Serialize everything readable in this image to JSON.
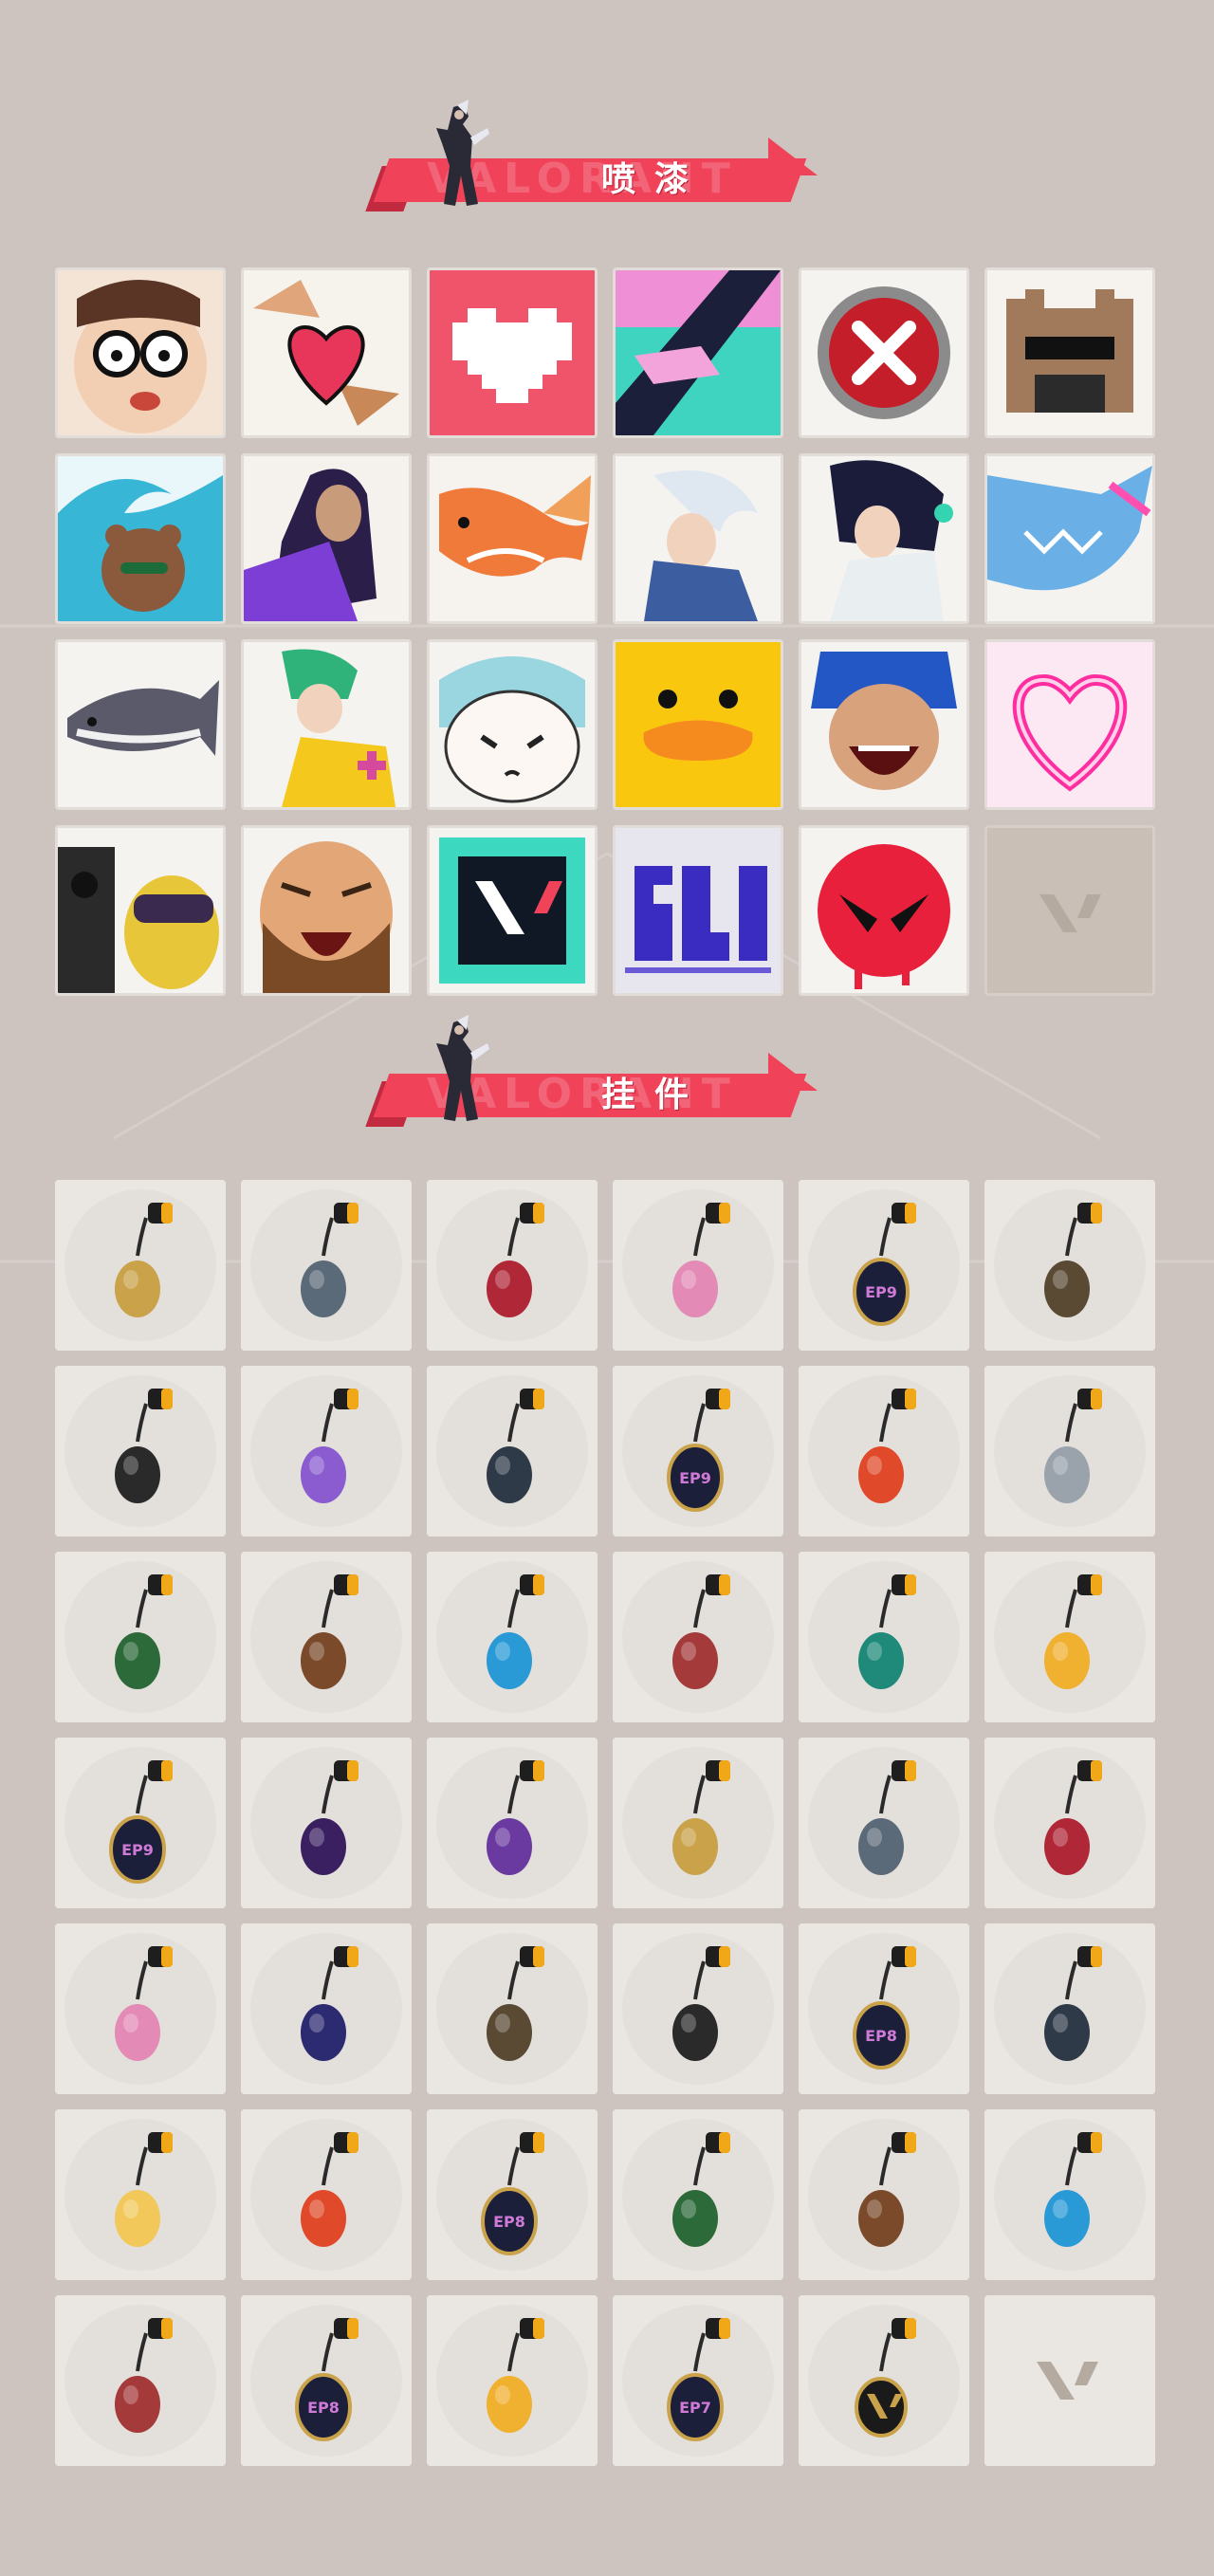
{
  "sections": {
    "sprays": {
      "title": "喷漆",
      "ghost_text": "VALORANT"
    },
    "buddies": {
      "title": "挂件",
      "ghost_text": "VALORANT"
    }
  },
  "colors": {
    "background": "#cdc4bf",
    "banner_red": "#f0435a",
    "tile": "#f1efec"
  },
  "sprays": [
    {
      "icon": "cartoon-face-glasses-spray"
    },
    {
      "icon": "hands-heart-spray"
    },
    {
      "icon": "pixel-heart-spray"
    },
    {
      "icon": "pink-gun-stripe-spray"
    },
    {
      "icon": "red-x-button-spray"
    },
    {
      "icon": "pixel-cat-sunglasses-spray"
    },
    {
      "icon": "bear-wave-spray"
    },
    {
      "icon": "reyna-agent-spray"
    },
    {
      "icon": "koi-fish-spray"
    },
    {
      "icon": "jett-agent-spray"
    },
    {
      "icon": "sage-agent-spray"
    },
    {
      "icon": "blue-shark-spray"
    },
    {
      "icon": "catfish-spray"
    },
    {
      "icon": "skye-agent-spray"
    },
    {
      "icon": "chibi-pouting-spray"
    },
    {
      "icon": "yellow-duck-spray"
    },
    {
      "icon": "neon-agent-yelling-spray"
    },
    {
      "icon": "neon-pink-heart-spray"
    },
    {
      "icon": "gun-masked-banana-spray"
    },
    {
      "icon": "laughing-bearded-man-spray"
    },
    {
      "icon": "valorant-logo-teal-spray"
    },
    {
      "icon": "graffiti-tag-spray"
    },
    {
      "icon": "red-angry-face-spray"
    },
    {
      "icon": "empty-slot-valorant-logo"
    }
  ],
  "buddies": [
    {
      "icon": "gold-cat-buddy"
    },
    {
      "icon": "toaster-buddy"
    },
    {
      "icon": "rope-noose-buddy"
    },
    {
      "icon": "cupcake-buddy"
    },
    {
      "icon": "ep9-medallion-buddy"
    },
    {
      "icon": "backpack-buddy"
    },
    {
      "icon": "black-hook-creature-buddy"
    },
    {
      "icon": "lava-lamp-buddy"
    },
    {
      "icon": "sneaker-buddy"
    },
    {
      "icon": "ep9-medallion-buddy"
    },
    {
      "icon": "purple-pixel-heart-buddy"
    },
    {
      "icon": "cheese-slice-buddy"
    },
    {
      "icon": "skewer-buddy"
    },
    {
      "icon": "robot-figure-buddy"
    },
    {
      "icon": "baseball-bat-buddy"
    },
    {
      "icon": "robot-box-buddy"
    },
    {
      "icon": "lute-buddy"
    },
    {
      "icon": "green-can-buddy"
    },
    {
      "icon": "ep9-medallion-buddy"
    },
    {
      "icon": "gold-robot-buddy"
    },
    {
      "icon": "corgi-buddy"
    },
    {
      "icon": "green-plant-creature-buddy"
    },
    {
      "icon": "raccoon-buddy"
    },
    {
      "icon": "mecha-robot-buddy"
    },
    {
      "icon": "blue-crystal-buddy"
    },
    {
      "icon": "red-blob-buddy"
    },
    {
      "icon": "green-gem-buddy"
    },
    {
      "icon": "sun-cloud-buddy"
    },
    {
      "icon": "ep8-medallion-buddy"
    },
    {
      "icon": "pretzel-buddy"
    },
    {
      "icon": "bottle-buddy"
    },
    {
      "icon": "purple-flame-flower-buddy"
    },
    {
      "icon": "ep8-medallion-buddy"
    },
    {
      "icon": "ufo-buddy"
    },
    {
      "icon": "koi-fish-buddy"
    },
    {
      "icon": "grey-cat-buddy"
    },
    {
      "icon": "potted-plant-buddy"
    },
    {
      "icon": "ep8-medallion-buddy"
    },
    {
      "icon": "lion-head-buddy"
    },
    {
      "icon": "ep7-medallion-buddy"
    },
    {
      "icon": "valorant-logo-buddy"
    },
    {
      "icon": "empty-slot-valorant-logo"
    }
  ]
}
